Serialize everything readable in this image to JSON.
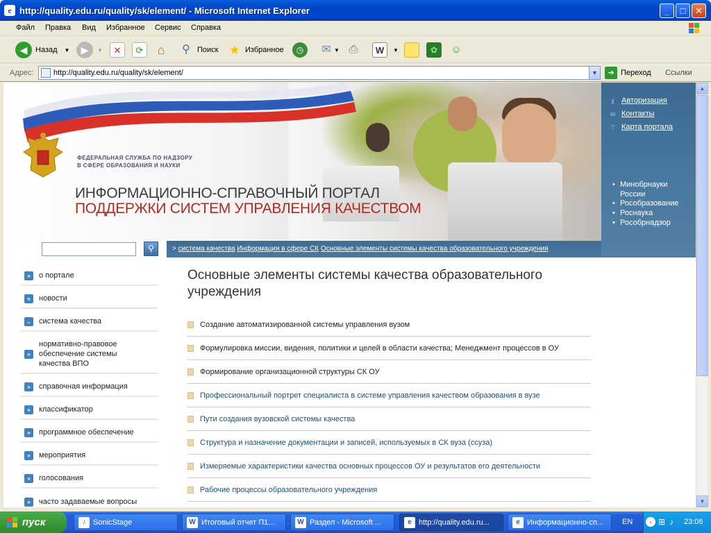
{
  "window": {
    "title": "http://quality.edu.ru/quality/sk/element/ - Microsoft Internet Explorer"
  },
  "menu": [
    "Файл",
    "Правка",
    "Вид",
    "Избранное",
    "Сервис",
    "Справка"
  ],
  "toolbar": {
    "back_label": "Назад",
    "search_label": "Поиск",
    "favorites_label": "Избранное"
  },
  "address": {
    "label": "Адрес:",
    "url": "http://quality.edu.ru/quality/sk/element/",
    "go_label": "Переход",
    "links_label": "Ссылки"
  },
  "site": {
    "agency_line1": "ФЕДЕРАЛЬНАЯ СЛУЖБА ПО НАДЗОРУ",
    "agency_line2": "В СФЕРЕ ОБРАЗОВАНИЯ И НАУКИ",
    "portal_line1": "ИНФОРМАЦИОННО-СПРАВОЧНЫЙ ПОРТАЛ",
    "portal_line2": "ПОДДЕРЖКИ СИСТЕМ УПРАВЛЕНИЯ КАЧЕСТВОМ",
    "top_links": [
      "Авторизация",
      "Контакты",
      "Карта портала"
    ],
    "ministry_links": [
      "Минобрнауки России",
      "Рособразование",
      "Роснаука",
      "Рособрнадзор"
    ],
    "breadcrumb": {
      "prefix": ">",
      "items": [
        "система качества",
        "Информация в сфере СК",
        "Основные элементы системы качества образовательного учреждения"
      ]
    },
    "nav": [
      "о портале",
      "новости",
      "система качества",
      "нормативно-правовое обеспечение системы качества ВПО",
      "справочная информация",
      "классификатор",
      "программное обеспечение",
      "мероприятия",
      "голосования",
      "часто задаваемые вопросы"
    ],
    "page_title": "Основные элементы системы качества образовательного учреждения",
    "articles": [
      "Создание автоматизированной системы управления вузом",
      "Формулировка миссии, видения, политики и целей в области качества; Менеджмент процессов в ОУ",
      "Формирование организационной структуры СК ОУ",
      "Профессиональный портрет специалиста в системе управления качеством образования в вузе",
      "Пути создания вузовской системы качества",
      "Структура и назначение документации и записей, используемых в СК вуза (ссуза)",
      "Измеряемые характеристики качества основных процессов ОУ и результатов его деятельности",
      "Рабочие процессы образовательного учреждения"
    ]
  },
  "taskbar": {
    "start_label": "пуск",
    "tasks": [
      "SonicStage",
      "Итоговый отчет П1...",
      "Раздел - Microsoft ...",
      "http://quality.edu.ru...",
      "Информационно-сп..."
    ],
    "lang": "EN",
    "clock": "23:06"
  },
  "colors": {
    "accent": "#3f82c3",
    "panel_blue": "#4a7aa1",
    "portal_red": "#b22a1e"
  }
}
